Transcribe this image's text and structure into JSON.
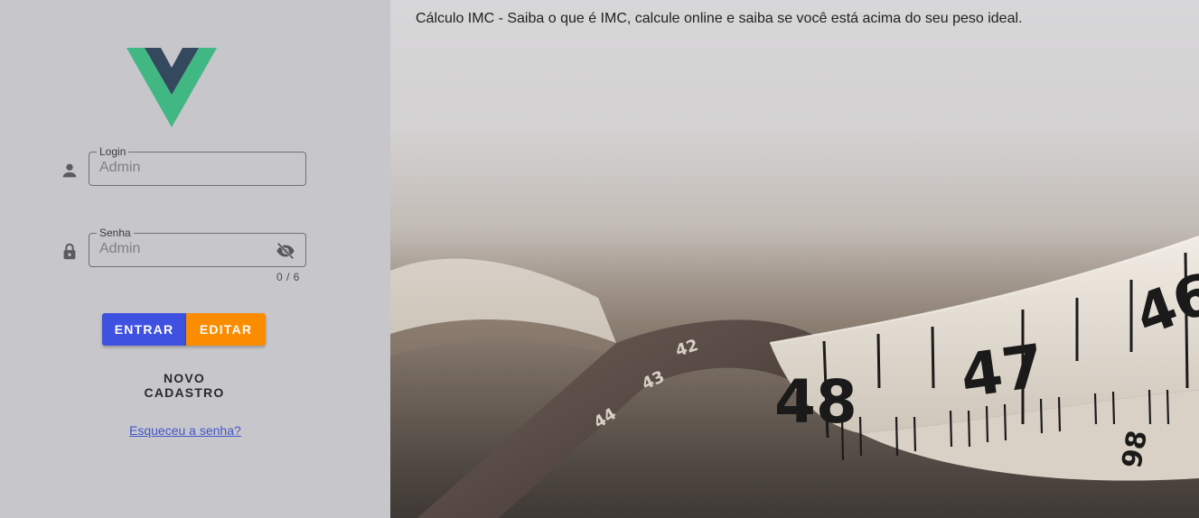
{
  "header": {
    "title": "Cálculo IMC - Saiba o que é IMC, calcule online e saiba se você está acima do seu peso ideal."
  },
  "login_form": {
    "login": {
      "label": "Login",
      "placeholder": "Admin",
      "icon": "person-icon"
    },
    "password": {
      "label": "Senha",
      "placeholder": "Admin",
      "icon": "lock-icon",
      "toggle_icon": "eye-off-icon",
      "counter": "0 / 6"
    },
    "buttons": {
      "entrar": "ENTRAR",
      "editar": "EDITAR",
      "novo_cadastro": "NOVO CADASTRO"
    },
    "forgot_link": "Esqueceu a senha?"
  },
  "tape_numbers": {
    "left_1": "42",
    "left_2": "43",
    "left_3": "44",
    "big_1": "48",
    "big_2": "47",
    "big_3": "46",
    "bottom": "98"
  },
  "colors": {
    "left_panel": "#c6c6cb",
    "entrar_button": "#3f51e0",
    "editar_button": "#fb8c00",
    "link": "#4457c9",
    "logo_green": "#41b883",
    "logo_dark": "#35495e"
  }
}
